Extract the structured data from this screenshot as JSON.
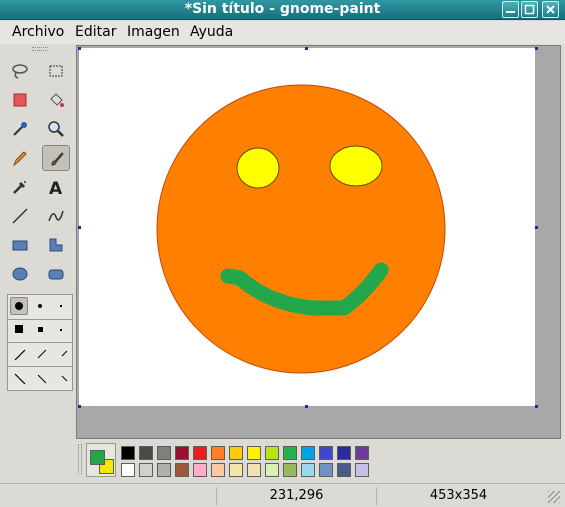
{
  "window": {
    "title": "*Sin título - gnome-paint"
  },
  "menu": {
    "items": [
      "Archivo",
      "Editar",
      "Imagen",
      "Ayuda"
    ]
  },
  "status": {
    "cursor_position": "231,296",
    "image_size": "453x354"
  },
  "colors": {
    "primary": "#22a84a",
    "secondary": "#f5e800",
    "face": "#ff8000",
    "eyes": "#ffff00",
    "mouth": "#22a84a"
  },
  "palette": {
    "row1": [
      "#000000",
      "#4a4a4a",
      "#7f7f7f",
      "#9b1030",
      "#e8201c",
      "#ff7f27",
      "#ffc90e",
      "#fff200",
      "#b5e61d",
      "#22b14c",
      "#00a2e8",
      "#3f48cc",
      "#2b2b9a",
      "#6a3d9a"
    ],
    "row2": [
      "#ffffff",
      "#d0d0d0",
      "#b0b0b0",
      "#9a5a3a",
      "#ffaec9",
      "#ffc8a0",
      "#f5e6a8",
      "#efe4b0",
      "#d8f0b0",
      "#99b860",
      "#99d9ea",
      "#7092be",
      "#4a5a8a",
      "#c8bfe7"
    ]
  },
  "tools": [
    "lasso-select-icon",
    "rect-select-icon",
    "eraser-icon",
    "fill-bucket-icon",
    "color-picker-icon",
    "zoom-icon",
    "pencil-icon",
    "paintbrush-icon",
    "airbrush-icon",
    "text-icon",
    "line-icon",
    "curve-icon",
    "rectangle-icon",
    "polygon-icon",
    "ellipse-icon",
    "rounded-rect-icon"
  ]
}
